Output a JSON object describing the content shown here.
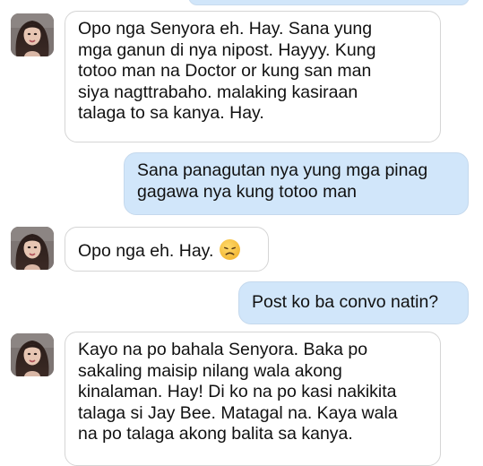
{
  "conversation": {
    "messages": [
      {
        "direction": "incoming",
        "lines": [
          "Opo nga Senyora eh. Hay. Sana yung",
          "mga ganun di nya nipost. Hayyy. Kung",
          "totoo man na Doctor or kung san man",
          "siya nagttrabaho. malaking kasiraan",
          "talaga to sa kanya. Hay."
        ]
      },
      {
        "direction": "outgoing",
        "lines": [
          "Sana panagutan nya yung mga pinag",
          "gagawa nya kung totoo man"
        ]
      },
      {
        "direction": "incoming",
        "lines": [
          "Opo nga eh. Hay."
        ],
        "emoji": "disappointed-face-icon"
      },
      {
        "direction": "outgoing",
        "lines": [
          "Post ko ba convo natin?"
        ]
      },
      {
        "direction": "incoming",
        "lines": [
          "Kayo na po bahala Senyora. Baka po",
          "sakaling maisip nilang wala akong",
          "kinalaman. Hay! Di ko na po kasi nakikita",
          "talaga si Jay Bee. Matagal na. Kaya wala",
          "na po talaga akong balita sa kanya."
        ]
      }
    ]
  },
  "colors": {
    "outgoing_bubble": "#d1e6fa",
    "incoming_bubble": "#ffffff",
    "bubble_border": "#d5d5d5",
    "text": "#111111"
  }
}
